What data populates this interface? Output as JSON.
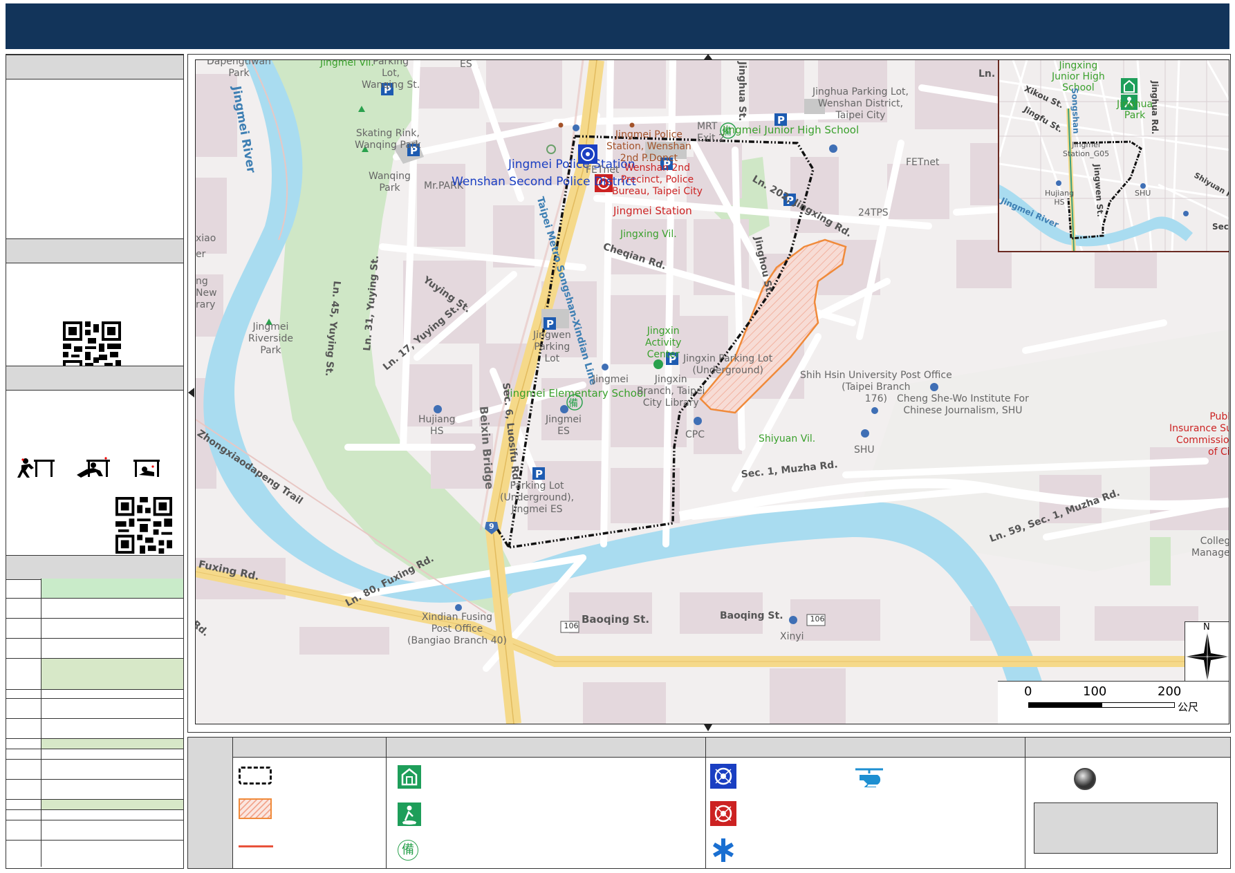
{
  "map": {
    "labels": {
      "dapengtiwan_park": "Dapengtiwan\nPark",
      "jingmei_river": "Jingmei River",
      "jingmei_vil": "Jingmei Vil.",
      "parking_lot_wanqing": "Parking\nLot,\nWanqing St.",
      "es_top": "ES",
      "ln": "Ln.",
      "skating_rink": "Skating Rink,\nWanqing Park",
      "wanqing_park": "Wanqing\nPark",
      "mr_park": "Mr.PARK",
      "jingmei_police_station_wenshan": "Jingmei Police\nStation, Wenshan\n2nd P.Donct",
      "mrt_exit2": "MRT\nExit 2",
      "jingmei_junior_high": "Jingmei Junior High School",
      "jinghua_parking": "Jinghua Parking Lot,\nWenshan District,\nTaipei City",
      "jinghua_st": "Jinghua St.",
      "jingmei_police_station": "Jingmei Police Station",
      "wenshan_second_police": "Wenshan Second Police District",
      "fetnet_left": "FETnet",
      "wenshan_2nd_police_bureau": "Wenshan 2nd\nPrecinct, Police\nBureau, Taipei City",
      "jingmei_station": "Jingmei Station",
      "fetnet_right": "FETnet",
      "ln_202_jingxing": "Ln. 202, Jingxing Rd.",
      "twenty_four_tps": "24TPS",
      "jingxing_vil": "Jingxing Vil.",
      "cheqian_rd": "Cheqian Rd.",
      "jinghou_st": "Jinghou St.",
      "xiao": "xiao",
      "er": "er",
      "ng_new_library": "ng\nNew\nrary",
      "ln45_yuying": "Ln. 45, Yuying St.",
      "ln31_yuying": "Ln. 31, Yuying St.",
      "yuying_st": "Yuying St.",
      "ln17_yuying": "Ln. 17, Yuying St.",
      "metro_songshan": "Taipei Metro Songshan-Xindian Line",
      "jingmei_riverside_park": "Jingmei\nRiverside\nPark",
      "jingwen_parking": "Jingwen\nParking\nLot",
      "jingxin_activity": "Jingxin\nActivity\nCenter",
      "jingxin_parking": "Jingxin Parking Lot\n(Underground)",
      "jingmei_small": "Jingmei",
      "jingmei_elementary": "Jingmei Elementary School",
      "jingxin_branch_library": "Jingxin\nBranch, Taipei\nCity Library",
      "hujiang_hs": "Hujiang\nHS",
      "jingmei_es": "Jingmei\nES",
      "sec6_luosifu": "Sec. 6, Luosifu Rd.",
      "beixin_bridge": "Beixin Bridge",
      "cpc": "CPC",
      "shiyuan_vil": "Shiyuan Vil.",
      "shu": "SHU",
      "shih_hsin_post": "Shih Hsin University Post Office\n(Taipei Branch\n176)",
      "cheng_shewo": "Cheng She-Wo Institute For\nChinese Journalism, SHU",
      "public_insurance": "Public\nInsurance Sup\nCommission,\nof Civi",
      "zhongxiaodapeng": "Zhongxiaodapeng Trail",
      "parking_underground_jingmei": "Parking Lot\n(Underground),\nJingmei ES",
      "sec1_muzha": "Sec. 1, Muzha Rd.",
      "ln59_muzha": "Ln. 59, Sec. 1, Muzha Rd.",
      "college_manage": "College o\nManageme",
      "fuxing_rd": "Fuxing Rd.",
      "ln80_fuxing": "Ln. 80, Fuxing Rd.",
      "xindian_fusing_post": "Xindian Fusing\nPost Office\n(Bangiao Branch 40)",
      "baoqing_st_1": "Baoqing St.",
      "baoqing_st_2": "Baoqing St.",
      "rd_bottom": "Rd.",
      "xinyi": "Xinyi",
      "route_106_a": "106",
      "route_106_b": "106",
      "route_9": "9"
    },
    "inset": {
      "jingxing_jhs": "Jingxing\nJunior High\nSchool",
      "jinghua_park": "Jinghua\nPark",
      "xikou_st": "Xikou St.",
      "jingfu_st": "Jingfu St.",
      "jingmei_station_g05": "Jingmei\nStation_G05",
      "jingwen_st": "Jingwen St.",
      "hujiang_hs": "Hujiang\nHS",
      "jingmei_river": "Jingmei River",
      "shu": "SHU",
      "shiyuan_rd": "Shiyuan Rd.",
      "jinghua_rd": "Jinghua Rd.",
      "sec": "Sec",
      "songshan": "Songshan"
    },
    "scale": {
      "t0": "0",
      "t1": "100",
      "t2": "200",
      "unit": "公尺"
    },
    "north": "N"
  },
  "legend_icons": {
    "study_glyph": "備"
  },
  "colors": {
    "header": "#12345a",
    "river": "#a9dcf0",
    "park": "#cfe7c6",
    "road_major": "#f5d98a",
    "block": "#e4d8dd",
    "hazard": "#f08a3a",
    "boundary": "#111111",
    "police_blue": "#1a3fc2",
    "police_red": "#cc2222",
    "shelter_green": "#1e9e5a"
  }
}
